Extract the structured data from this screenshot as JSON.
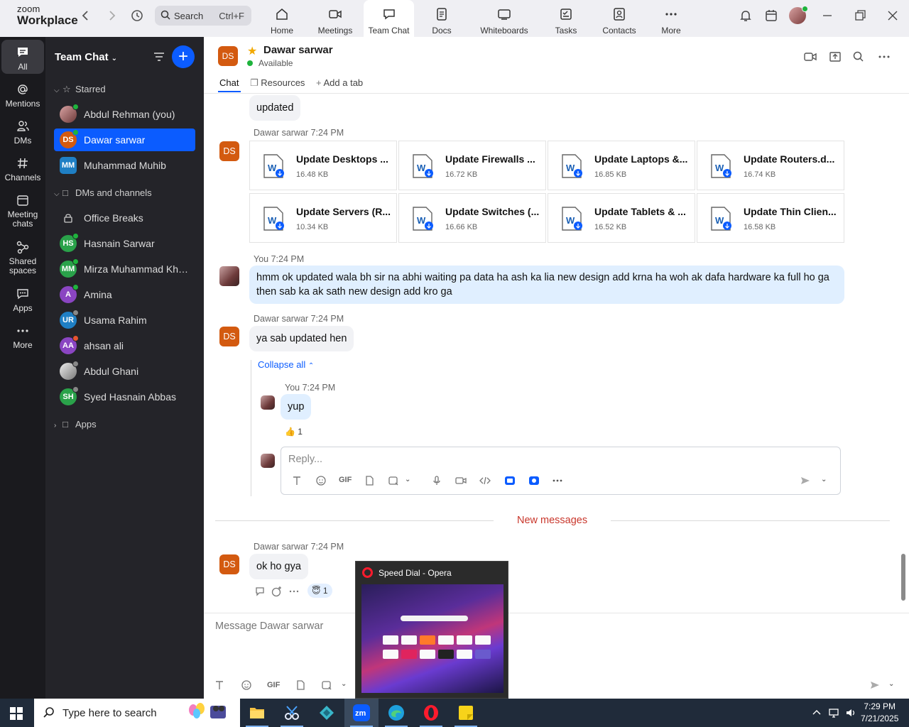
{
  "app": {
    "brand_line1": "zoom",
    "brand_line2": "Workplace",
    "search_label": "Search",
    "search_shortcut": "Ctrl+F"
  },
  "top_tabs": [
    {
      "label": "Home",
      "icon": "home-icon"
    },
    {
      "label": "Meetings",
      "icon": "video-icon"
    },
    {
      "label": "Team Chat",
      "icon": "chat-icon",
      "active": true
    },
    {
      "label": "Docs",
      "icon": "doc-icon"
    },
    {
      "label": "Whiteboards",
      "icon": "whiteboard-icon"
    },
    {
      "label": "Tasks",
      "icon": "tasks-icon"
    },
    {
      "label": "Contacts",
      "icon": "contacts-icon"
    },
    {
      "label": "More",
      "icon": "more-icon"
    }
  ],
  "rail": [
    {
      "label": "All",
      "icon": "chat-bubble-icon",
      "active": true
    },
    {
      "label": "Mentions",
      "icon": "at-icon"
    },
    {
      "label": "DMs",
      "icon": "people-icon"
    },
    {
      "label": "Channels",
      "icon": "hash-icon"
    },
    {
      "label": "Meeting chats",
      "icon": "calendar-icon"
    },
    {
      "label": "Shared spaces",
      "icon": "shared-icon"
    },
    {
      "label": "Apps",
      "icon": "apps-icon"
    },
    {
      "label": "More",
      "icon": "more-dots-icon"
    }
  ],
  "sidebar": {
    "title": "Team Chat",
    "starred_label": "Starred",
    "dms_label": "DMs and channels",
    "apps_label": "Apps",
    "starred": [
      {
        "name": "Abdul Rehman (you)",
        "initials": "",
        "color": "#8a4a4a",
        "presence": "#1eb33c",
        "photo": true
      },
      {
        "name": "Dawar sarwar",
        "initials": "DS",
        "color": "#d35a10",
        "presence": "#1eb33c",
        "selected": true
      },
      {
        "name": "Muhammad Muhib",
        "initials": "MM",
        "color": "#1f7fc4",
        "presence": ""
      }
    ],
    "dms": [
      {
        "name": "Office Breaks",
        "initials": "",
        "color": "",
        "lock": true
      },
      {
        "name": "Hasnain Sarwar",
        "initials": "HS",
        "color": "#2aa24a",
        "presence": "#1eb33c"
      },
      {
        "name": "Mirza Muhammad Khurram",
        "initials": "MM",
        "color": "#2aa24a",
        "presence": "#1eb33c"
      },
      {
        "name": "Amina",
        "initials": "A",
        "color": "#8a45c2",
        "presence": "#1eb33c"
      },
      {
        "name": "Usama Rahim",
        "initials": "UR",
        "color": "#1f7fc4",
        "presence": "#888888"
      },
      {
        "name": "ahsan ali",
        "initials": "AA",
        "color": "#8a45c2",
        "presence": "#e8542f"
      },
      {
        "name": "Abdul Ghani",
        "initials": "",
        "color": "#cfcfcf",
        "presence": "#888888",
        "photo": true
      },
      {
        "name": "Syed Hasnain Abbas",
        "initials": "SH",
        "color": "#2aa24a",
        "presence": "#888888"
      }
    ]
  },
  "chat": {
    "contact_name": "Dawar sarwar",
    "contact_initials": "DS",
    "contact_status": "Available",
    "tabs": [
      "Chat",
      "Resources",
      "Add a tab"
    ],
    "msg_updated": "updated",
    "files_sender": "Dawar sarwar 7:24 PM",
    "files": [
      {
        "name": "Update Desktops ...",
        "size": "16.48 KB"
      },
      {
        "name": "Update Firewalls ...",
        "size": "16.72 KB"
      },
      {
        "name": "Update Laptops &...",
        "size": "16.85 KB"
      },
      {
        "name": "Update Routers.d...",
        "size": "16.74 KB"
      },
      {
        "name": "Update Servers (R...",
        "size": "10.34 KB"
      },
      {
        "name": "Update Switches (...",
        "size": "16.66 KB"
      },
      {
        "name": "Update Tablets & ...",
        "size": "16.52 KB"
      },
      {
        "name": "Update Thin Clien...",
        "size": "16.58 KB"
      }
    ],
    "my_sender": "You 7:24 PM",
    "my_message": "hmm ok updated wala bh sir na abhi waiting pa data ha ash ka lia new  design add krna ha woh ak dafa hardware ka full ho ga then sab ka ak sath new design add kro ga",
    "reply_sender": "Dawar sarwar 7:24 PM",
    "reply_message": "ya sab updated hen",
    "collapse_label": "Collapse all",
    "thread_sender": "You 7:24 PM",
    "thread_message": "yup",
    "thread_reaction_count": "1",
    "reply_placeholder": "Reply...",
    "gif_label": "GIF",
    "new_messages_label": "New messages",
    "last_sender": "Dawar sarwar 7:24 PM",
    "last_message": "ok ho gya",
    "last_reaction_count": "1",
    "compose_placeholder": "Message Dawar sarwar"
  },
  "preview": {
    "title": "Speed Dial - Opera"
  },
  "taskbar": {
    "search_placeholder": "Type here to search",
    "time": "7:29 PM",
    "date": "7/21/2025"
  },
  "colors": {
    "accent": "#0b5cff",
    "new_messages": "#c9372c",
    "ds_avatar": "#d35a10"
  }
}
